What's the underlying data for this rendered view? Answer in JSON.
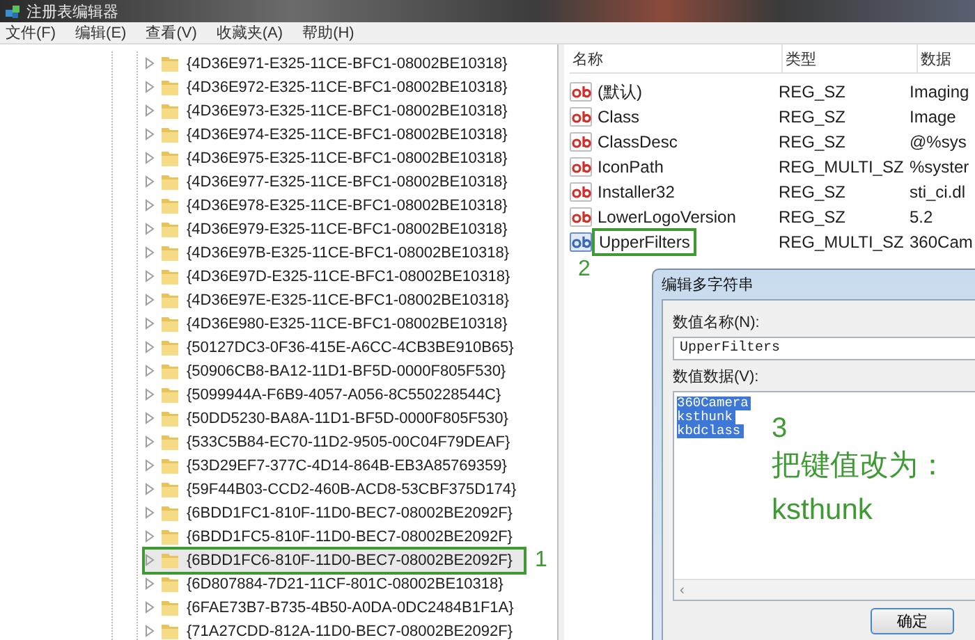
{
  "window": {
    "title": "注册表编辑器"
  },
  "menu": [
    "文件(F)",
    "编辑(E)",
    "查看(V)",
    "收藏夹(A)",
    "帮助(H)"
  ],
  "tree": {
    "items": [
      {
        "label": "{4D36E971-E325-11CE-BFC1-08002BE10318}",
        "selected": false
      },
      {
        "label": "{4D36E972-E325-11CE-BFC1-08002BE10318}",
        "selected": false
      },
      {
        "label": "{4D36E973-E325-11CE-BFC1-08002BE10318}",
        "selected": false
      },
      {
        "label": "{4D36E974-E325-11CE-BFC1-08002BE10318}",
        "selected": false
      },
      {
        "label": "{4D36E975-E325-11CE-BFC1-08002BE10318}",
        "selected": false
      },
      {
        "label": "{4D36E977-E325-11CE-BFC1-08002BE10318}",
        "selected": false
      },
      {
        "label": "{4D36E978-E325-11CE-BFC1-08002BE10318}",
        "selected": false
      },
      {
        "label": "{4D36E979-E325-11CE-BFC1-08002BE10318}",
        "selected": false
      },
      {
        "label": "{4D36E97B-E325-11CE-BFC1-08002BE10318}",
        "selected": false
      },
      {
        "label": "{4D36E97D-E325-11CE-BFC1-08002BE10318}",
        "selected": false
      },
      {
        "label": "{4D36E97E-E325-11CE-BFC1-08002BE10318}",
        "selected": false
      },
      {
        "label": "{4D36E980-E325-11CE-BFC1-08002BE10318}",
        "selected": false
      },
      {
        "label": "{50127DC3-0F36-415E-A6CC-4CB3BE910B65}",
        "selected": false
      },
      {
        "label": "{50906CB8-BA12-11D1-BF5D-0000F805F530}",
        "selected": false
      },
      {
        "label": "{5099944A-F6B9-4057-A056-8C550228544C}",
        "selected": false
      },
      {
        "label": "{50DD5230-BA8A-11D1-BF5D-0000F805F530}",
        "selected": false
      },
      {
        "label": "{533C5B84-EC70-11D2-9505-00C04F79DEAF}",
        "selected": false
      },
      {
        "label": "{53D29EF7-377C-4D14-864B-EB3A85769359}",
        "selected": false
      },
      {
        "label": "{59F44B03-CCD2-460B-ACD8-53CBF375D174}",
        "selected": false
      },
      {
        "label": "{6BDD1FC1-810F-11D0-BEC7-08002BE2092F}",
        "selected": false
      },
      {
        "label": "{6BDD1FC5-810F-11D0-BEC7-08002BE2092F}",
        "selected": false
      },
      {
        "label": "{6BDD1FC6-810F-11D0-BEC7-08002BE2092F}",
        "selected": true,
        "annotation": "1"
      },
      {
        "label": "{6D807884-7D21-11CF-801C-08002BE10318}",
        "selected": false
      },
      {
        "label": "{6FAE73B7-B735-4B50-A0DA-0DC2484B1F1A}",
        "selected": false
      },
      {
        "label": "{71A27CDD-812A-11D0-BEC7-08002BE2092F}",
        "selected": false
      }
    ]
  },
  "values": {
    "columns": [
      "名称",
      "类型",
      "数据"
    ],
    "rows": [
      {
        "name": "(默认)",
        "type": "REG_SZ",
        "data": "Imaging",
        "selected": false
      },
      {
        "name": "Class",
        "type": "REG_SZ",
        "data": "Image",
        "selected": false
      },
      {
        "name": "ClassDesc",
        "type": "REG_SZ",
        "data": "@%sys",
        "selected": false
      },
      {
        "name": "IconPath",
        "type": "REG_MULTI_SZ",
        "data": "%syster",
        "selected": false
      },
      {
        "name": "Installer32",
        "type": "REG_SZ",
        "data": "sti_ci.dl",
        "selected": false
      },
      {
        "name": "LowerLogoVersion",
        "type": "REG_SZ",
        "data": "5.2",
        "selected": false
      },
      {
        "name": "UpperFilters",
        "type": "REG_MULTI_SZ",
        "data": "360Cam",
        "selected": true,
        "annotation": "2"
      }
    ]
  },
  "dialog": {
    "title": "编辑多字符串",
    "name_label": "数值名称(N):",
    "name_value": "UpperFilters",
    "data_label": "数值数据(V):",
    "data_lines": [
      "360Camera",
      "ksthunk",
      "kbdclass"
    ],
    "data_selected": true,
    "scroll_arrow": "‹",
    "ok_button": "确定",
    "annotation": {
      "step": "3",
      "lines": [
        "把键值改为：",
        "ksthunk"
      ]
    }
  }
}
